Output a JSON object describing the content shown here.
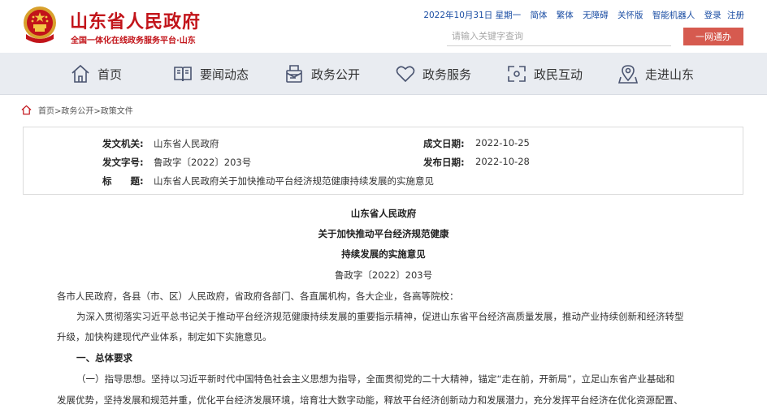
{
  "header": {
    "site_name": "山东省人民政府",
    "tagline": "全国一体化在线政务服务平台·山东",
    "date": "2022年10月31日 星期一",
    "links": [
      "简体",
      "繁体",
      "无障碍",
      "关怀版",
      "智能机器人",
      "登录",
      "注册"
    ],
    "search_placeholder": "请输入关键字查询",
    "search_button": "一网通办"
  },
  "nav": {
    "items": [
      {
        "label": "首页",
        "icon": "home-icon"
      },
      {
        "label": "要闻动态",
        "icon": "book-icon"
      },
      {
        "label": "政务公开",
        "icon": "document-icon"
      },
      {
        "label": "政务服务",
        "icon": "heart-icon"
      },
      {
        "label": "政民互动",
        "icon": "interaction-icon"
      },
      {
        "label": "走进山东",
        "icon": "location-icon"
      }
    ]
  },
  "breadcrumb": {
    "text": "首页>政务公开>政策文件"
  },
  "meta": {
    "issuer_label": "发文机关:",
    "issuer": "山东省人民政府",
    "doc_no_label": "发文字号:",
    "doc_no": "鲁政字〔2022〕203号",
    "title_label": "标　　题:",
    "title": "山东省人民政府关于加快推动平台经济规范健康持续发展的实施意见",
    "written_label": "成文日期:",
    "written": "2022-10-25",
    "published_label": "发布日期:",
    "published": "2022-10-28"
  },
  "article": {
    "title_lines": [
      "山东省人民政府",
      "关于加快推动平台经济规范健康",
      "持续发展的实施意见"
    ],
    "doc_no": "鲁政字〔2022〕203号",
    "salutation": "各市人民政府，各县（市、区）人民政府，省政府各部门、各直属机构，各大企业，各高等院校：",
    "intro_1": "为深入贯彻落实习近平总书记关于推动平台经济规范健康持续发展的重要指示精神，促进山东省平台经济高质量发展，推动产业持续创新和经济转型",
    "intro_2": "升级，加快构建现代产业体系，制定如下实施意见。",
    "section_1": "一、总体要求",
    "p1_1": "（一）指导思想。坚持以习近平新时代中国特色社会主义思想为指导，全面贯彻党的二十大精神，锚定“走在前，开新局”，立足山东省产业基础和",
    "p1_2": "发展优势，坚持发展和规范并重，优化平台经济发展环境，培育壮大数字动能，释放平台经济创新动力和发展潜力，充分发挥平台经济在优化资源配置、"
  },
  "colors": {
    "brand_red": "#c2141a",
    "link_blue": "#1a4da3",
    "button_red": "#d65a4f",
    "nav_bg": "#e9ecf1"
  }
}
